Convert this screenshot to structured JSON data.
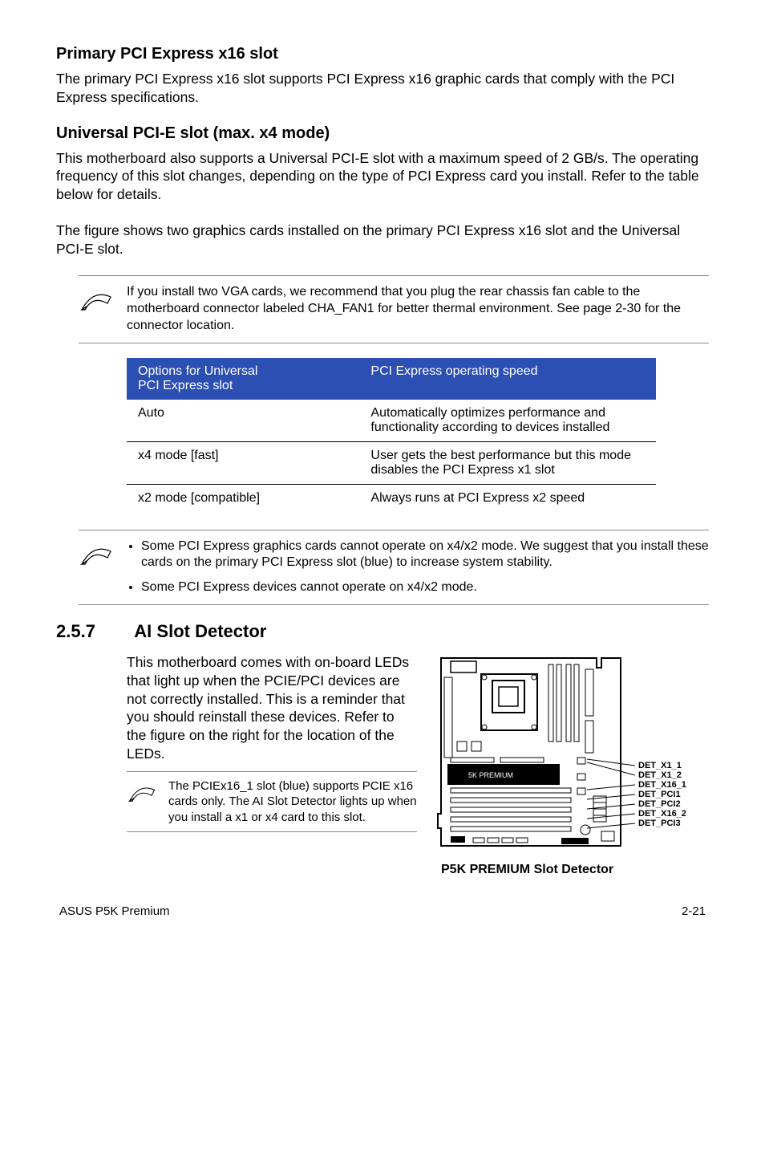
{
  "headings": {
    "primary": "Primary PCI Express x16 slot",
    "universal": "Universal PCI-E slot (max. x4 mode)"
  },
  "paragraphs": {
    "primary_body": "The primary PCI Express x16 slot supports PCI Express x16 graphic cards that comply with the PCI Express specifications.",
    "universal_body1": "This motherboard also supports a Universal PCI-E slot with a maximum speed of 2 GB/s. The operating frequency of this slot changes, depending on the type of PCI Express card you install. Refer to the table below for details.",
    "universal_body2": "The figure shows two graphics cards installed on the primary PCI Express x16 slot and the Universal PCI-E slot."
  },
  "notes": {
    "note1": "If you install two VGA cards, we recommend that you plug the rear chassis fan cable to the motherboard connector labeled CHA_FAN1 for better thermal environment. See page 2-30 for the connector location.",
    "note2_item1": "Some PCI Express graphics cards cannot operate on x4/x2 mode. We suggest that you install these cards on the primary PCI Express slot (blue) to increase system stability.",
    "note2_item2": "Some PCI Express devices cannot operate on x4/x2 mode."
  },
  "table": {
    "head_col1_line1": "Options for Universal",
    "head_col1_line2": "PCI Express slot",
    "head_col2": "PCI Express operating speed",
    "rows": [
      {
        "c1": "Auto",
        "c2": "Automatically optimizes performance and functionality according to devices installed"
      },
      {
        "c1": "x4 mode [fast]",
        "c2": "User gets the best performance but this mode disables the PCI Express x1 slot"
      },
      {
        "c1": "x2 mode [compatible]",
        "c2": "Always runs at PCI Express x2 speed"
      }
    ]
  },
  "section": {
    "num": "2.5.7",
    "title": "AI Slot Detector",
    "body": "This motherboard comes with on-board LEDs that light up when the PCIE/PCI devices are not correctly installed. This is a reminder that you should reinstall these devices. Refer to the figure on the right for the location of the LEDs.",
    "note": "The PCIEx16_1 slot (blue) supports PCIE x16 cards only. The AI Slot Detector lights up when you install a x1 or x4 card to this slot."
  },
  "figure": {
    "caption": "P5K PREMIUM Slot Detector",
    "labels": {
      "l1": "DET_X1_1",
      "l2": "DET_X1_2",
      "l3": "DET_X16_1",
      "l4": "DET_PCI1",
      "l5": "DET_PCI2",
      "l6": "DET_X16_2",
      "l7": "DET_PCI3"
    },
    "board_text": "5K PREMIUM"
  },
  "footer": {
    "left": "ASUS P5K Premium",
    "right": "2-21"
  }
}
